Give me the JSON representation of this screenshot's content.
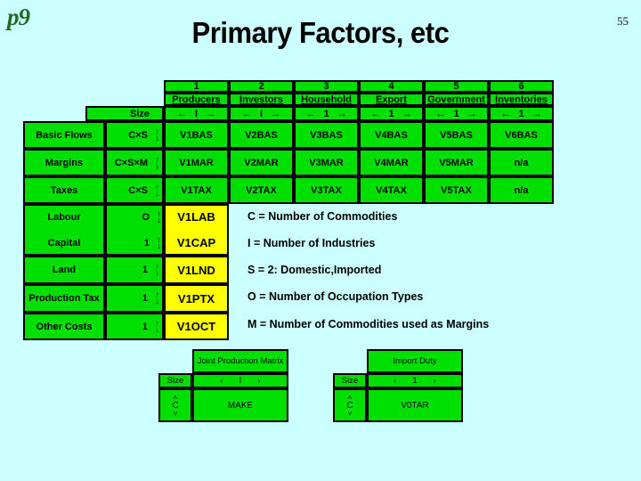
{
  "slide": {
    "logo": "p9",
    "page_number": "55",
    "title": "Primary Factors, etc",
    "background_color": "#ccffff",
    "accent_green": "#00e000",
    "accent_yellow": "#ffff00"
  },
  "main_table": {
    "size_header": "Size",
    "columns": [
      {
        "number": "1",
        "name": "Producers",
        "size": "I"
      },
      {
        "number": "2",
        "name": "Investors",
        "size": "I"
      },
      {
        "number": "3",
        "name": "Household",
        "size": "1"
      },
      {
        "number": "4",
        "name": "Export",
        "size": "1"
      },
      {
        "number": "5",
        "name": "Government",
        "size": "1"
      },
      {
        "number": "6",
        "name": "Inventories",
        "size": "1"
      }
    ],
    "arrow_left": "←",
    "arrow_right": "→",
    "arrow_up": "↑",
    "arrow_down": "↓",
    "rows": [
      {
        "label": "Basic Flows",
        "size": "C×S",
        "cells": [
          "V1BAS",
          "V2BAS",
          "V3BAS",
          "V4BAS",
          "V5BAS",
          "V6BAS"
        ]
      },
      {
        "label": "Margins",
        "size": "C×S×M",
        "cells": [
          "V1MAR",
          "V2MAR",
          "V3MAR",
          "V4MAR",
          "V5MAR",
          "n/a"
        ]
      },
      {
        "label": "Taxes",
        "size": "C×S",
        "cells": [
          "V1TAX",
          "V2TAX",
          "V3TAX",
          "V4TAX",
          "V5TAX",
          "n/a"
        ]
      },
      {
        "label": "Labour",
        "size": "O",
        "cells": [
          "V1LAB"
        ]
      },
      {
        "label": "Capital",
        "size": "1",
        "cells": [
          "V1CAP"
        ]
      },
      {
        "label": "Land",
        "size": "1",
        "cells": [
          "V1LND"
        ]
      },
      {
        "label": "Production Tax",
        "size": "1",
        "cells": [
          "V1PTX"
        ]
      },
      {
        "label": "Other Costs",
        "size": "1",
        "cells": [
          "V1OCT"
        ]
      }
    ]
  },
  "legend": [
    "C = Number of Commodities",
    "I  = Number of Industries",
    "S = 2: Domestic,Imported",
    "O = Number of Occupation Types",
    "M  =   Number of Commodities used as Margins"
  ],
  "mini_tables": [
    {
      "title": "Joint Production Matrix",
      "size_header": "Size",
      "col_size": "I",
      "row_size": "C",
      "body": "MAKE"
    },
    {
      "title": "Import Duty",
      "size_header": "Size",
      "col_size": "1",
      "row_size": "C",
      "body": "V0TAR"
    }
  ]
}
